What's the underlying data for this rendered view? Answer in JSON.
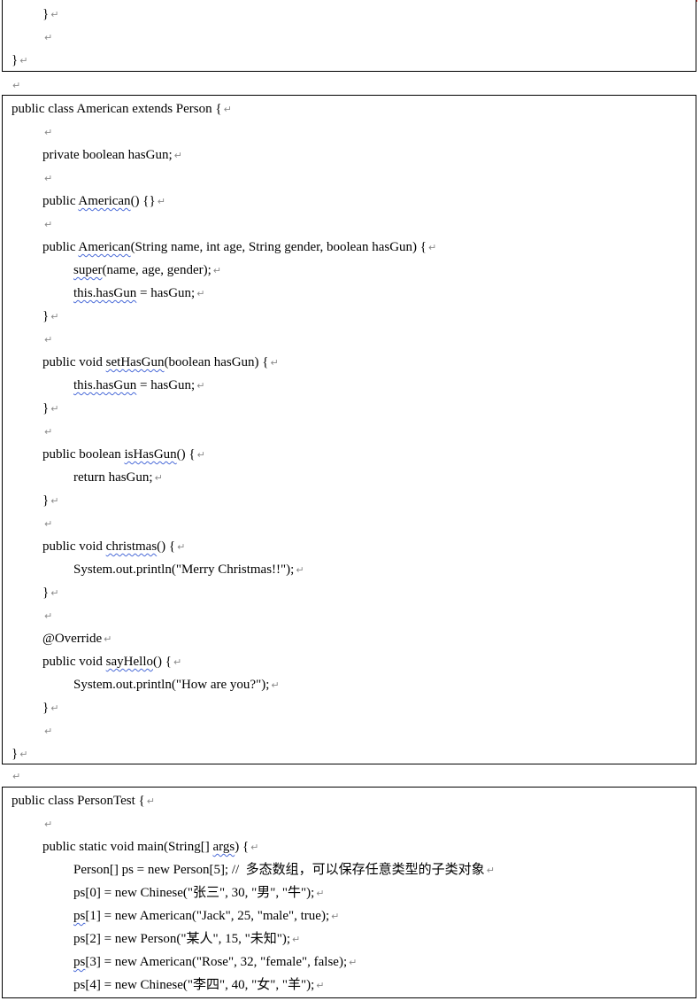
{
  "mark": "↵",
  "top_block": {
    "lines": [
      "}",
      "",
      "}"
    ]
  },
  "american": {
    "l1": "public class American extends Person {",
    "l3": "private boolean hasGun;",
    "l5a": "public ",
    "l5b": "American",
    "l5c": "() {}",
    "l7a": "public ",
    "l7b": "American",
    "l7c": "(String name, int age, String gender, boolean hasGun) {",
    "l8a": "super",
    "l8b": "(name, age, gender);",
    "l9a": "this.hasGun",
    "l9b": " = hasGun;",
    "l10": "}",
    "l12a": "public void ",
    "l12b": "setHasGun",
    "l12c": "(boolean hasGun) {",
    "l13a": "this.hasGun",
    "l13b": " = hasGun;",
    "l14": "}",
    "l16a": "public boolean ",
    "l16b": "isHasGun",
    "l16c": "() {",
    "l17": "return hasGun;",
    "l18": "}",
    "l20a": "public void ",
    "l20b": "christmas",
    "l20c": "() {",
    "l21": "System.out.println(\"Merry Christmas!!\");",
    "l22": "}",
    "l24": "@Override",
    "l25a": "public void ",
    "l25b": "sayHello",
    "l25c": "() {",
    "l26": "System.out.println(\"How are you?\");",
    "l27": "}",
    "l29": "}"
  },
  "persontest": {
    "l1": "public class PersonTest {",
    "l3a": "public static void main(String[] ",
    "l3b": "args",
    "l3c": ") {",
    "l4": "Person[] ps = new Person[5]; //  多态数组，可以保存任意类型的子类对象",
    "l5": "ps[0] = new Chinese(\"张三\", 30, \"男\", \"牛\");",
    "l6a": "ps",
    "l6b": "[1] = new American(\"Jack\", 25, \"male\", true);",
    "l7": "ps[2] = new Person(\"某人\", 15, \"未知\");",
    "l8a": "ps",
    "l8b": "[3] = new American(\"Rose\", 32, \"female\", false);",
    "l9": "ps[4] = new Chinese(\"李四\", 40, \"女\", \"羊\");"
  }
}
